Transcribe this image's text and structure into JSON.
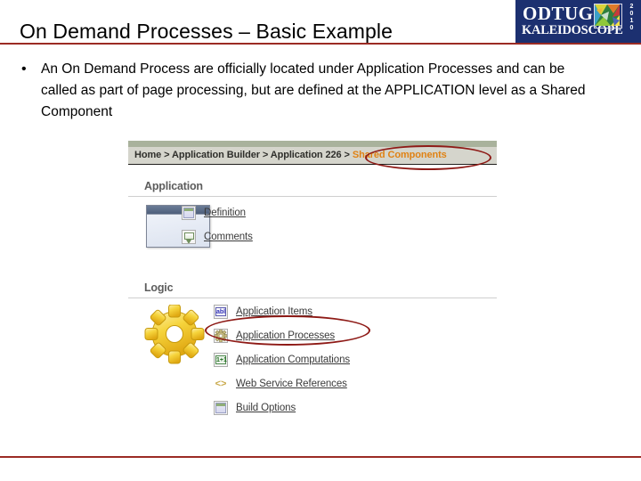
{
  "slide": {
    "title": "On Demand Processes – Basic Example",
    "bullet_mark": "•",
    "bullet_text": "An On Demand Process are officially located under Application Processes and can be called as part of page processing, but are defined at the APPLICATION level as a Shared Component",
    "rule_color": "#9b2b24"
  },
  "logo": {
    "primary": "ODTUG",
    "secondary": "KALEIDOSCOPE",
    "year": "2010",
    "background": "#1c3070",
    "text_color": "#ffffff"
  },
  "apex": {
    "breadcrumb": {
      "home": "Home",
      "sep": " > ",
      "builder": "Application Builder",
      "application": "Application 226",
      "current": "Shared Components",
      "current_color": "#e08214",
      "highlight_color": "#8e1a16"
    },
    "sections": [
      {
        "heading": "Application",
        "links": [
          {
            "label": "Definition",
            "icon": "window-icon"
          },
          {
            "label": "Comments",
            "icon": "comment-bubble-icon"
          }
        ]
      },
      {
        "heading": "Logic",
        "links": [
          {
            "label": "Application Items",
            "icon": "abl-textfield-icon",
            "glyph": "abl"
          },
          {
            "label": "Application Processes",
            "icon": "gear-icon"
          },
          {
            "label": "Application Computations",
            "icon": "sum-icon",
            "glyph": "1+1"
          },
          {
            "label": "Web Service References",
            "icon": "angle-brackets-icon",
            "glyph": "<>"
          },
          {
            "label": "Build Options",
            "icon": "window-icon"
          }
        ]
      }
    ],
    "highlighted_link": "Application Processes"
  }
}
